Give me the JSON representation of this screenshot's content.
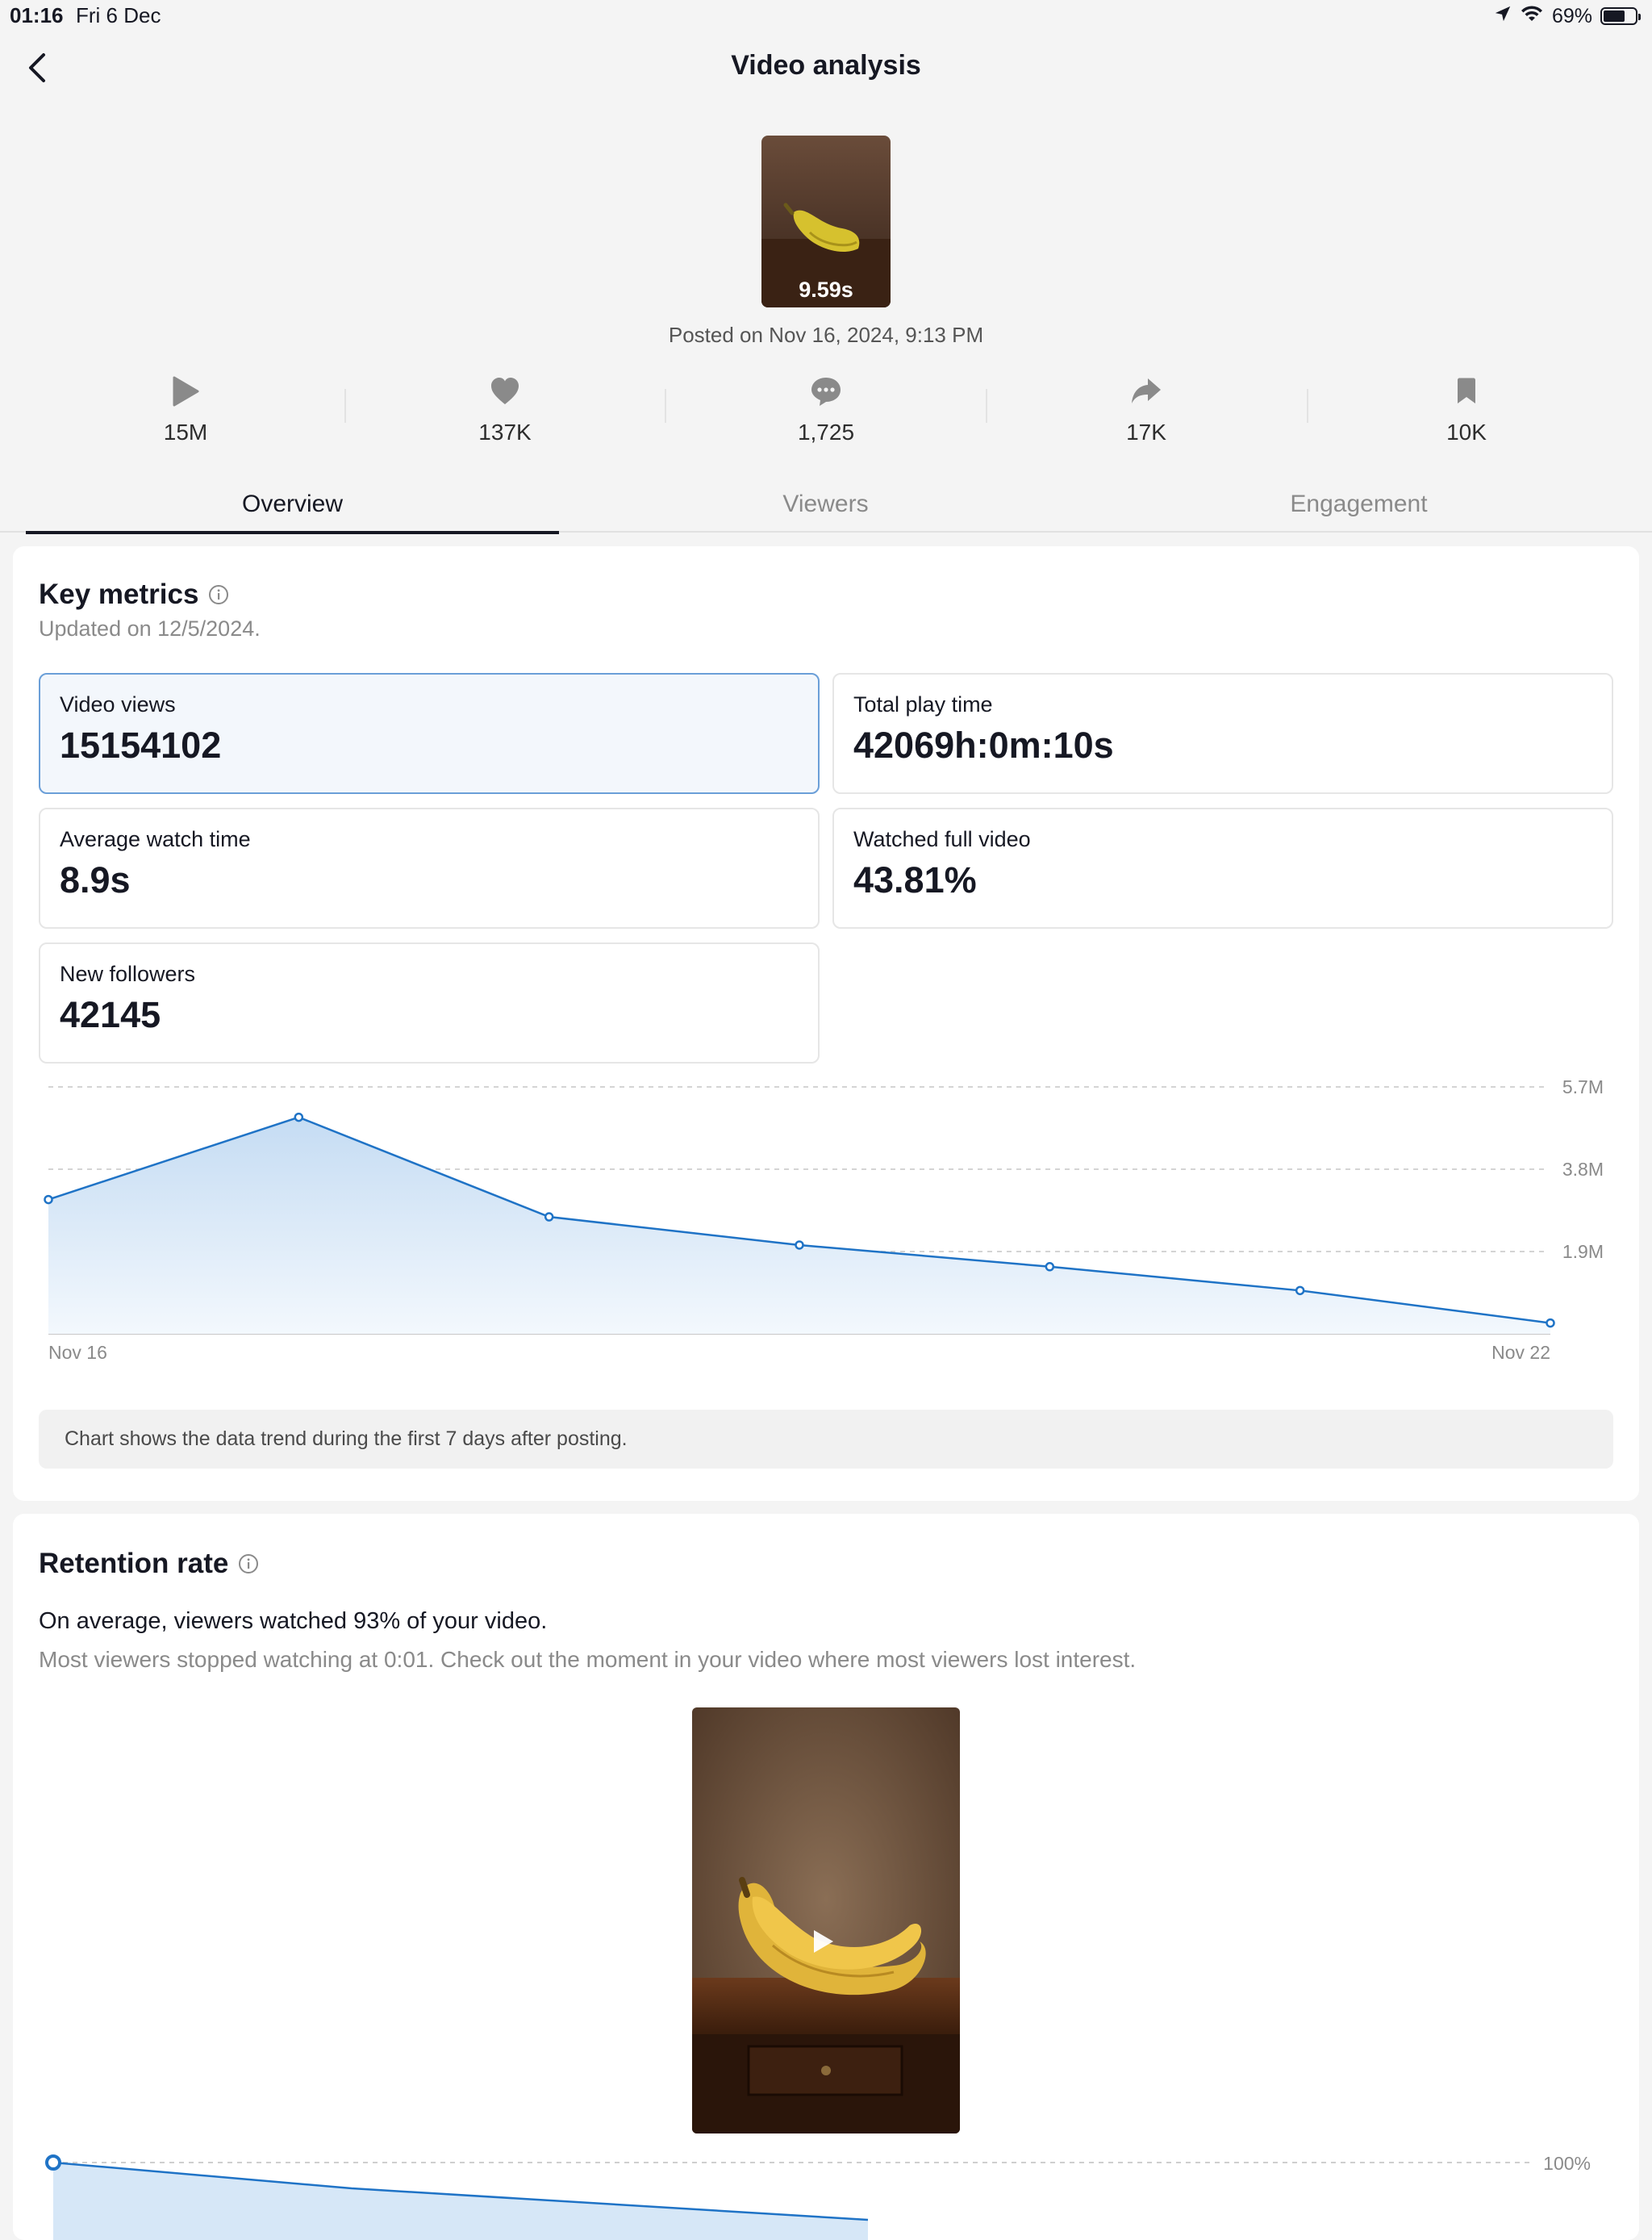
{
  "status_bar": {
    "time": "01:16",
    "date": "Fri 6 Dec",
    "battery": "69%"
  },
  "header": {
    "title": "Video analysis"
  },
  "video": {
    "duration": "9.59s",
    "posted": "Posted on Nov 16, 2024, 9:13 PM"
  },
  "stats": [
    {
      "icon": "play-icon",
      "value": "15M"
    },
    {
      "icon": "heart-icon",
      "value": "137K"
    },
    {
      "icon": "comment-icon",
      "value": "1,725"
    },
    {
      "icon": "share-icon",
      "value": "17K"
    },
    {
      "icon": "bookmark-icon",
      "value": "10K"
    }
  ],
  "tabs": [
    {
      "label": "Overview",
      "active": true
    },
    {
      "label": "Viewers",
      "active": false
    },
    {
      "label": "Engagement",
      "active": false
    }
  ],
  "key_metrics": {
    "title": "Key metrics",
    "updated": "Updated on 12/5/2024.",
    "items": [
      {
        "label": "Video views",
        "value": "15154102",
        "selected": true
      },
      {
        "label": "Total play time",
        "value": "42069h:0m:10s",
        "selected": false
      },
      {
        "label": "Average watch time",
        "value": "8.9s",
        "selected": false
      },
      {
        "label": "Watched full video",
        "value": "43.81%",
        "selected": false
      },
      {
        "label": "New followers",
        "value": "42145",
        "selected": false
      }
    ],
    "chart_note": "Chart shows the data trend during the first 7 days after posting."
  },
  "chart_data": {
    "type": "area",
    "x": [
      "Nov 16",
      "Nov 17",
      "Nov 18",
      "Nov 19",
      "Nov 20",
      "Nov 21",
      "Nov 22"
    ],
    "x_tick_labels": [
      "Nov 16",
      "Nov 22"
    ],
    "y_tick_labels": [
      "5.7M",
      "3.8M",
      "1.9M"
    ],
    "y_ticks": [
      5.7,
      3.8,
      1.9
    ],
    "values": [
      3.1,
      5.0,
      2.7,
      2.05,
      1.55,
      1.0,
      0.25
    ],
    "ylim": [
      0,
      5.7
    ],
    "unit": "M",
    "grid": true,
    "color": "#1f73c6"
  },
  "retention": {
    "title": "Retention rate",
    "headline": "On average, viewers watched 93% of your video.",
    "sub": "Most viewers stopped watching at 0:01. Check out the moment in your video where most viewers lost interest.",
    "y_tick_label": "100%"
  }
}
